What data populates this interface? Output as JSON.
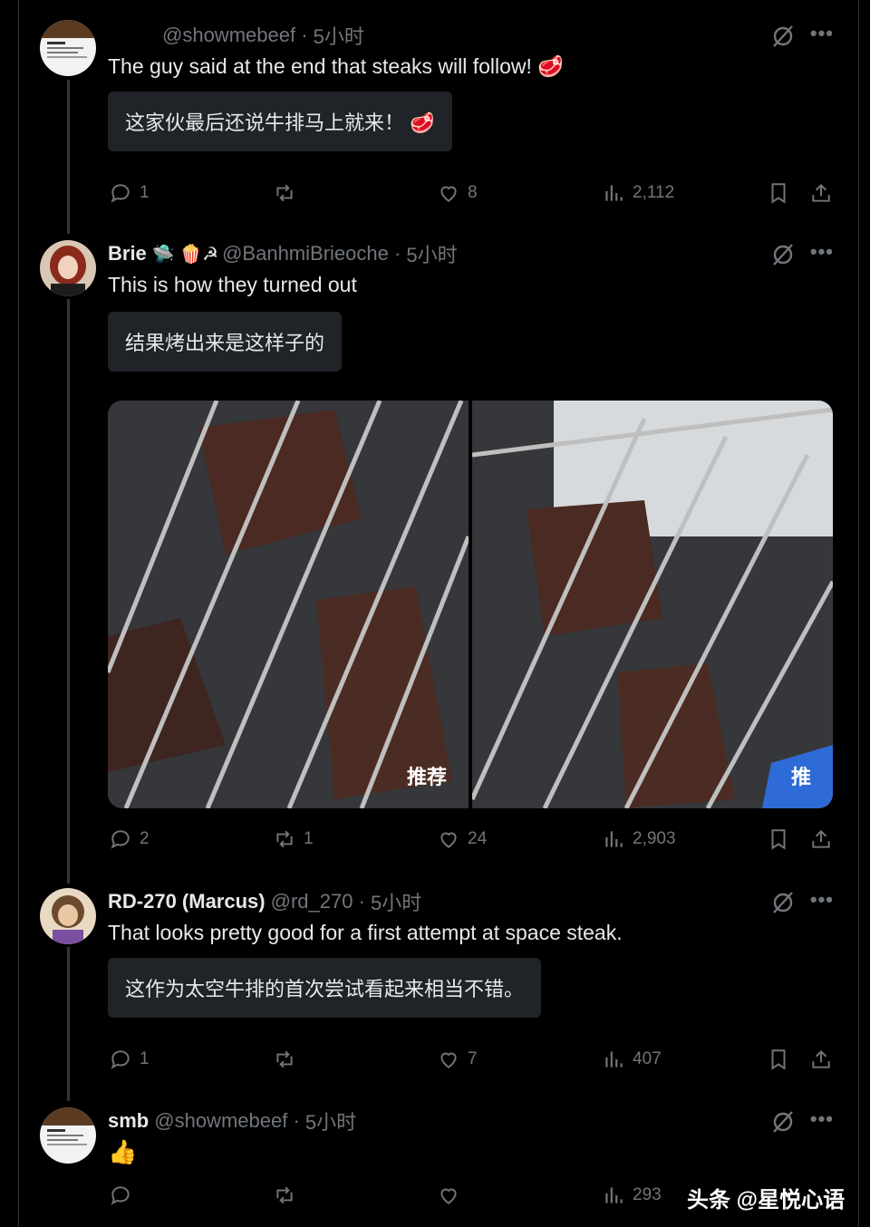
{
  "tweets": [
    {
      "name": "",
      "handle": "@showmebeef",
      "time": "5小时",
      "text": "The guy said at the end that steaks will follow! 🥩",
      "translation": "这家伙最后还说牛排马上就来！ 🥩",
      "replies": "1",
      "retweets": "",
      "likes": "8",
      "views": "2,112"
    },
    {
      "name": "Brie",
      "badges": "🛸 🍿☭",
      "handle": "@BanhmiBrieoche",
      "time": "5小时",
      "text": "This is how they turned out",
      "translation": "结果烤出来是这样子的",
      "replies": "2",
      "retweets": "1",
      "likes": "24",
      "views": "2,903",
      "photo_watermark_left": "推荐",
      "photo_watermark_right": "推"
    },
    {
      "name": "RD-270 (Marcus)",
      "handle": "@rd_270",
      "time": "5小时",
      "text": "That looks pretty good for a first attempt at space steak.",
      "translation": "这作为太空牛排的首次尝试看起来相当不错。",
      "replies": "1",
      "retweets": "",
      "likes": "7",
      "views": "407"
    },
    {
      "name": "smb",
      "handle": "@showmebeef",
      "time": "5小时",
      "text": "👍",
      "replies": "",
      "retweets": "",
      "likes": "",
      "views": "293"
    }
  ],
  "source_watermark": "头条 @星悦心语",
  "colors": {
    "background": "#000000",
    "text": "#e7e9ea",
    "muted": "#71767b",
    "translation_bg": "#202327"
  }
}
